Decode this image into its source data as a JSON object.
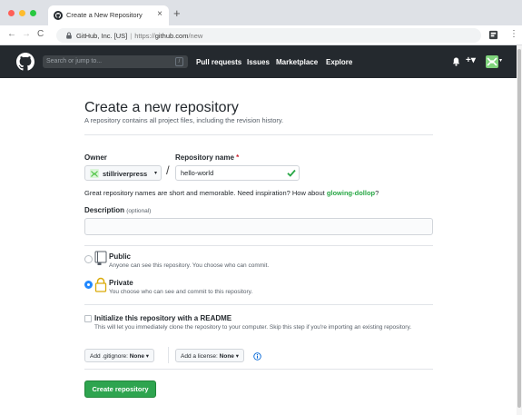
{
  "browser": {
    "tab_title": "Create a New Repository",
    "tab_close": "×",
    "new_tab": "+",
    "back": "←",
    "forward": "→",
    "reload": "C",
    "site_identity": "GitHub, Inc. [US]",
    "url_scheme": "https://",
    "url_host": "github.com",
    "url_path": "/new",
    "menu": "⋮"
  },
  "header": {
    "search_placeholder": "Search or jump to...",
    "search_shortcut": "/",
    "nav": [
      "Pull requests",
      "Issues",
      "Marketplace",
      "Explore"
    ],
    "plus": "+▾",
    "caret": "▾"
  },
  "page": {
    "title": "Create a new repository",
    "subtitle": "A repository contains all project files, including the revision history."
  },
  "form": {
    "owner_label": "Owner",
    "owner_value": "stillriverpress",
    "owner_caret": "▾",
    "slash": "/",
    "repo_label": "Repository name",
    "required_mark": "*",
    "repo_value": "hello-world",
    "hint_prefix": "Great repository names are short and memorable. Need inspiration? How about ",
    "hint_suggestion": "glowing-dollop",
    "hint_suffix": "?",
    "description_label": "Description",
    "description_optional": "(optional)",
    "description_value": ""
  },
  "visibility": {
    "public_title": "Public",
    "public_desc": "Anyone can see this repository. You choose who can commit.",
    "private_title": "Private",
    "private_desc": "You choose who can see and commit to this repository.",
    "selected": "private"
  },
  "init": {
    "readme_title": "Initialize this repository with a README",
    "readme_desc": "This will let you immediately clone the repository to your computer. Skip this step if you're importing an existing repository.",
    "readme_checked": false,
    "gitignore_label": "Add .gitignore:",
    "gitignore_value": "None",
    "license_label": "Add a license:",
    "license_value": "None",
    "caret": "▾"
  },
  "actions": {
    "create_label": "Create repository"
  },
  "colors": {
    "header_bg": "#24292e",
    "primary_button": "#2ea44f",
    "suggestion": "#28a745",
    "radio_selected": "#2188ff"
  },
  "icons": [
    "github-octocat-icon",
    "lock-icon",
    "extension-icon",
    "bell-icon",
    "avatar",
    "owner-avatar-icon",
    "check-icon",
    "repo-book-icon",
    "padlock-icon",
    "info-icon"
  ]
}
